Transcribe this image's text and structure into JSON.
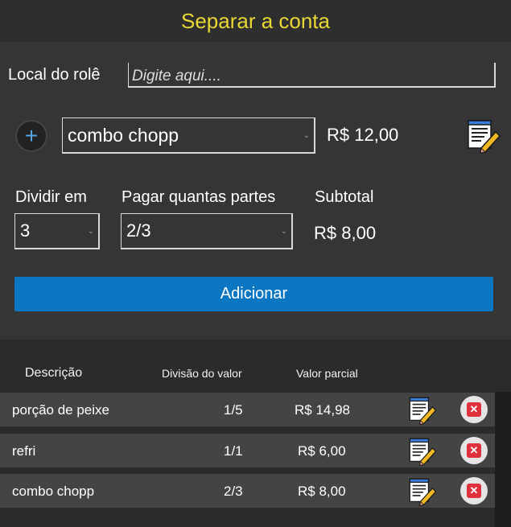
{
  "header": {
    "title": "Separar a conta"
  },
  "form": {
    "local_label": "Local do rolê",
    "local_placeholder": "Digite aqui....",
    "item_select_value": "combo chopp",
    "item_price": "R$ 12,00",
    "dividir_label": "Dividir em",
    "dividir_value": "3",
    "partes_label": "Pagar quantas partes",
    "partes_value": "2/3",
    "subtotal_label": "Subtotal",
    "subtotal_value": "R$ 8,00",
    "add_label": "Adicionar"
  },
  "table": {
    "headers": [
      "Descrição",
      "Divisão do valor",
      "Valor parcial"
    ],
    "rows": [
      {
        "desc": "porção de peixe",
        "div": "1/5",
        "val": "R$ 14,98"
      },
      {
        "desc": "refri",
        "div": "1/1",
        "val": "R$ 6,00"
      },
      {
        "desc": "combo chopp",
        "div": "2/3",
        "val": "R$ 8,00"
      }
    ]
  },
  "icons": {
    "add": "plus-icon",
    "edit": "notepad-pencil-icon",
    "delete": "close-icon",
    "dropdown": "chevron-down-icon"
  },
  "colors": {
    "title": "#e8d735",
    "primary_button": "#0d76c3",
    "plus_icon": "#58a6e6",
    "delete": "#e0303c"
  }
}
